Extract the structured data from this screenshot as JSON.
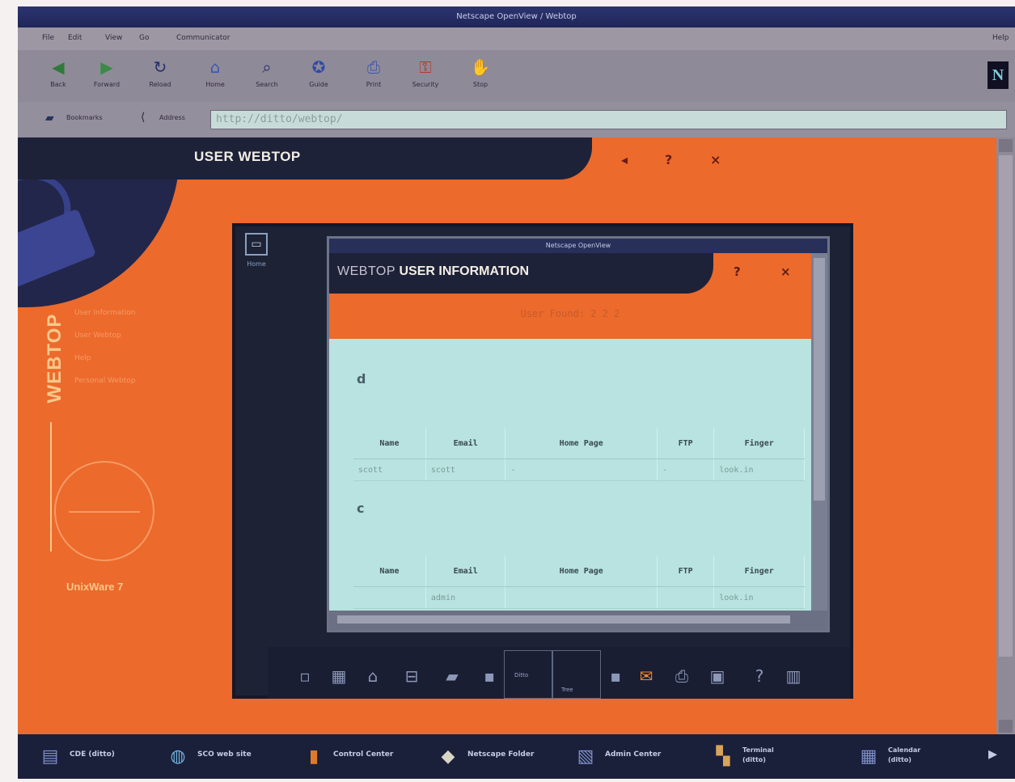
{
  "browser": {
    "title": "Netscape OpenView / Webtop",
    "menu": [
      "File",
      "Edit",
      "View",
      "Go",
      "Communicator",
      "Help"
    ],
    "toolbar": [
      {
        "label": "Back",
        "icon": "back-arrow-icon"
      },
      {
        "label": "Forward",
        "icon": "forward-arrow-icon"
      },
      {
        "label": "Reload",
        "icon": "reload-icon"
      },
      {
        "label": "Home",
        "icon": "home-icon"
      },
      {
        "label": "Search",
        "icon": "search-icon"
      },
      {
        "label": "Guide",
        "icon": "guide-icon"
      },
      {
        "label": "Print",
        "icon": "print-icon"
      },
      {
        "label": "Security",
        "icon": "security-icon"
      },
      {
        "label": "Stop",
        "icon": "stop-icon"
      }
    ],
    "location_labels": {
      "bookmarks": "Bookmarks",
      "address": "Address"
    },
    "url": "http://ditto/webtop/"
  },
  "page": {
    "title": "USER WEBTOP",
    "side_title": "WEBTOP",
    "side_links": [
      "User Information",
      "User Webtop",
      "Help",
      "Personal Webtop"
    ],
    "brand": "UnixWare 7"
  },
  "desktop": {
    "icon_label": "Home"
  },
  "app": {
    "window_title": "Netscape OpenView",
    "header_prefix": "WEBTOP",
    "header_main": "USER INFORMATION",
    "subtitle": "User Found: 2 2 2",
    "columns": [
      "Name",
      "Email",
      "Home Page",
      "FTP",
      "Finger"
    ],
    "sections": [
      {
        "letter": "d",
        "row": [
          "scott",
          "scott",
          "-",
          "-",
          "look.in"
        ]
      },
      {
        "letter": "c",
        "row": [
          "",
          "admin",
          "",
          "",
          "look.in"
        ]
      }
    ]
  },
  "inner_taskbar": {
    "labels": [
      "Ditto",
      "Tree"
    ]
  },
  "os_taskbar": [
    {
      "label": "CDE (ditto)"
    },
    {
      "label": "SCO web site"
    },
    {
      "label": "Control Center"
    },
    {
      "label": "Netscape Folder"
    },
    {
      "label": "Admin Center"
    },
    {
      "label": "Terminal (ditto)"
    },
    {
      "label": "Calendar (ditto)"
    }
  ],
  "colors": {
    "accent": "#ec6a2c",
    "dark": "#1e2238",
    "body": "#b8e3e0"
  }
}
